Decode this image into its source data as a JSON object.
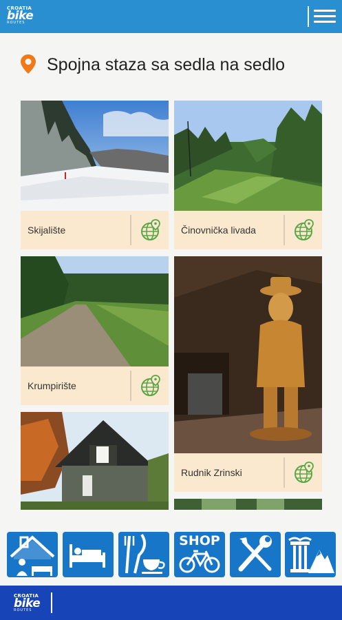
{
  "header": {
    "logo": {
      "line1": "CROATIA",
      "line2": "bike",
      "line3": "ROUTES"
    },
    "menu_icon": "hamburger-menu-icon"
  },
  "page": {
    "title": "Spojna staza sa sedla na sedlo",
    "title_icon": "location-pin-icon"
  },
  "cards": [
    {
      "caption": "Skijalište",
      "icon": "globe-map-pin-icon"
    },
    {
      "caption": "Činovnička livada",
      "icon": "globe-map-pin-icon"
    },
    {
      "caption": "Krumpirište",
      "icon": "globe-map-pin-icon"
    },
    {
      "caption": "Rudnik Zrinski",
      "icon": "globe-map-pin-icon"
    },
    {
      "caption": ""
    }
  ],
  "bottom_nav": [
    {
      "name": "sightseeing-house-icon"
    },
    {
      "name": "accommodation-bed-icon"
    },
    {
      "name": "food-cup-icon"
    },
    {
      "name": "bike-shop-icon",
      "label": "SHOP"
    },
    {
      "name": "service-tools-icon"
    },
    {
      "name": "culture-nature-icon"
    }
  ],
  "footer": {
    "logo": {
      "line1": "CROATIA",
      "line2": "bike",
      "line3": "ROUTES"
    }
  },
  "colors": {
    "header_blue": "#2a8fd0",
    "footer_blue": "#1744b7",
    "icon_blue": "#1776c8",
    "card_bg": "#fbe9cf",
    "pin_orange": "#f07a1a",
    "globe_green": "#5aa646"
  }
}
